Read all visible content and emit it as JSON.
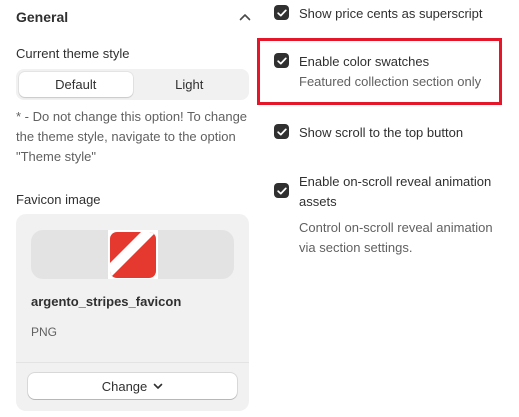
{
  "general": {
    "title": "General",
    "theme_style_label": "Current theme style",
    "theme_options": [
      "Default",
      "Light"
    ],
    "selected_theme": "Default",
    "help_text": "* - Do not change this option! To change the theme style, navigate to the option \"Theme style\"",
    "favicon": {
      "label": "Favicon image",
      "file_name": "argento_stripes_favicon",
      "file_type": "PNG",
      "change_label": "Change",
      "icon_color": "#e5392f"
    }
  },
  "options": [
    {
      "label": "Show price cents as superscript",
      "checked": true
    },
    {
      "label": "Enable color swatches",
      "help": "Featured collection section only",
      "checked": true,
      "highlighted": true
    },
    {
      "label": "Show scroll to the top button",
      "checked": true
    },
    {
      "label": "Enable on-scroll reveal animation assets",
      "help": "Control on-scroll reveal animation via section settings.",
      "checked": true
    }
  ],
  "colors": {
    "highlight": "#e5162a",
    "checkbox": "#303030",
    "card_bg": "#f1f1f1"
  }
}
